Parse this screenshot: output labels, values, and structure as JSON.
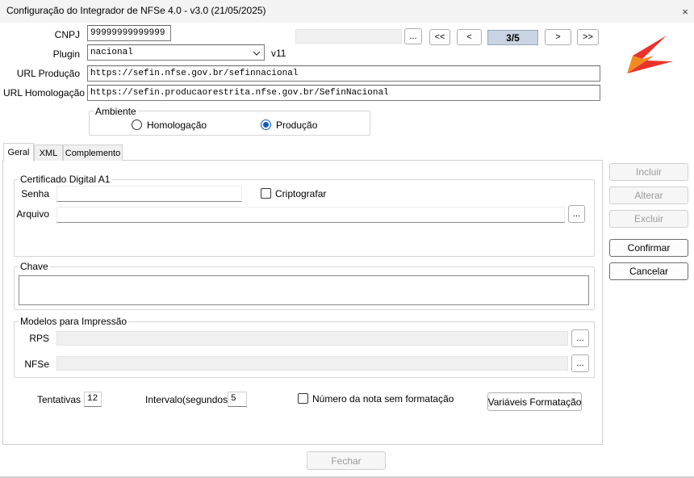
{
  "window": {
    "title": "Configuração do Integrador de NFSe 4.0 - v3.0 (21/05/2025)",
    "close_glyph": "×"
  },
  "header": {
    "cnpj_label": "CNPJ",
    "cnpj_value": "99999999999999",
    "plugin_label": "Plugin",
    "plugin_value": "nacional",
    "plugin_version": "v11",
    "url_producao_label": "URL Produção",
    "url_producao_value": "https://sefin.nfse.gov.br/sefinnacional",
    "url_homologacao_label": "URL Homologação",
    "url_homologacao_value": "https://sefin.producaorestrita.nfse.gov.br/SefinNacional"
  },
  "navigation": {
    "search_value": "",
    "browse_label": "...",
    "first_label": "<<",
    "prev_label": "<",
    "position": "3/5",
    "next_label": ">",
    "last_label": ">>"
  },
  "ambiente": {
    "title": "Ambiente",
    "options": [
      "Homologação",
      "Produção"
    ],
    "selected": "Produção"
  },
  "tabs": [
    "Geral",
    "XML",
    "Complemento"
  ],
  "active_tab": "Geral",
  "certificado": {
    "title": "Certificado Digital A1",
    "senha_label": "Senha",
    "senha_value": "",
    "criptografar_label": "Criptografar",
    "criptografar_checked": false,
    "arquivo_label": "Arquivo",
    "arquivo_value": "",
    "browse_label": "..."
  },
  "chave": {
    "title": "Chave",
    "value": ""
  },
  "modelos": {
    "title": "Modelos para Impressão",
    "rps_label": "RPS",
    "nfse_label": "NFSe",
    "browse_label": "..."
  },
  "options": {
    "tentativas_label": "Tentativas",
    "tentativas_value": "12",
    "intervalo_label": "Intervalo(segundos)",
    "intervalo_value": "5",
    "numero_sem_formatacao_label": "Número da nota sem formatação",
    "numero_sem_formatacao_checked": false,
    "variaveis_label": "Variáveis Formatação"
  },
  "actions": {
    "incluir": "Incluir",
    "alterar": "Alterar",
    "excluir": "Excluir",
    "confirmar": "Confirmar",
    "cancelar": "Cancelar",
    "fechar": "Fechar"
  },
  "colors": {
    "accent": "#0a5bbf",
    "logo_red": "#e8332b",
    "logo_orange": "#f59a1b",
    "nav_position_bg": "#c9d3e3"
  },
  "icons": {
    "logo": "brand-logo-z",
    "dropdown": "chevron-down-icon",
    "close": "close-icon"
  }
}
